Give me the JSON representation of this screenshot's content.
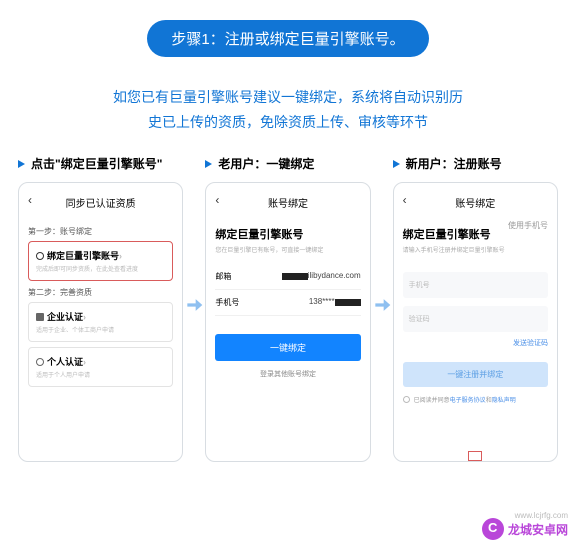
{
  "step": {
    "label": "步骤1：注册或绑定巨量引擎账号。"
  },
  "intro": {
    "line1": "如您已有巨量引擎账号建议一键绑定，系统将自动识别历",
    "line2": "史已上传的资质，免除资质上传、审核等环节"
  },
  "col1": {
    "title": "点击\"绑定巨量引擎账号\"",
    "header": "同步已认证资质",
    "sec1": "第一步：账号绑定",
    "pill_title": "绑定巨量引擎账号",
    "pill_sub": "完成后即可同步资质，在此处查看进度",
    "sec2": "第二步：完善资质",
    "biz_title": "企业认证",
    "biz_sub": "适用于企业、个体工商户申请",
    "per_title": "个人认证",
    "per_sub": "适用于个人用户申请"
  },
  "col2": {
    "title": "老用户：一键绑定",
    "header": "账号绑定",
    "h2": "绑定巨量引擎账号",
    "sub": "您在巨量引擎已有账号，可直接一键绑定",
    "f_email": "邮箱",
    "f_email_suffix": "ilibydance.com",
    "f_phone": "手机号",
    "f_phone_val": "138****",
    "btn": "一键绑定",
    "below": "登录其他账号绑定"
  },
  "col3": {
    "title": "新用户：注册账号",
    "header": "账号绑定",
    "h2": "绑定巨量引擎账号",
    "sub": "请输入手机号注册并绑定巨量引擎账号",
    "tab_phone": "使用手机号",
    "ph_phone": "手机号",
    "ph_code": "验证码",
    "send": "发送验证码",
    "btn": "一键注册并绑定",
    "tnc_pre": "已阅读并同意 ",
    "tnc_1": "电子服务协议",
    "tnc_mid": " 和 ",
    "tnc_2": "隐私声明"
  },
  "watermark": {
    "url": "www.lcjrfg.com",
    "name": "龙城安卓网"
  }
}
